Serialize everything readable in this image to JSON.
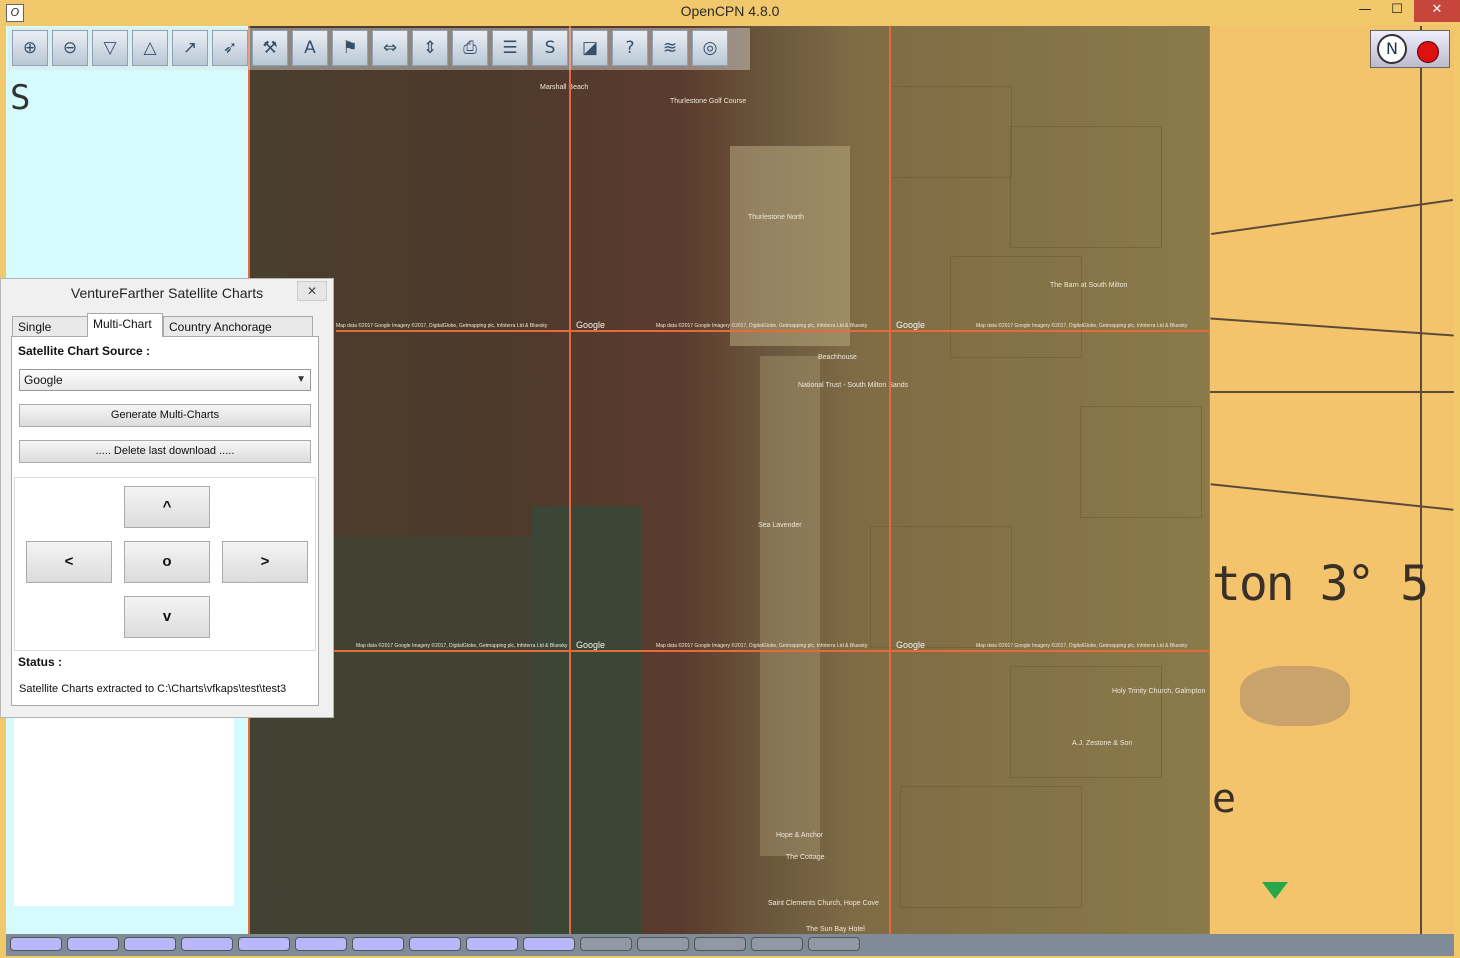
{
  "window": {
    "title": "OpenCPN 4.8.0",
    "app_icon": "O",
    "minimize_label": "—",
    "maximize_label": "☐",
    "close_label": "✕"
  },
  "toolbar": {
    "buttons": [
      {
        "name": "zoom-in-icon",
        "glyph": "⊕"
      },
      {
        "name": "zoom-out-icon",
        "glyph": "⊖"
      },
      {
        "name": "scale-in-icon",
        "glyph": "▽"
      },
      {
        "name": "scale-out-icon",
        "glyph": "△"
      },
      {
        "name": "route-icon",
        "glyph": "↗"
      },
      {
        "name": "auto-follow-icon",
        "glyph": "➶"
      },
      {
        "name": "settings-icon",
        "glyph": "⚒"
      },
      {
        "name": "text-icon",
        "glyph": "A"
      },
      {
        "name": "mark-icon",
        "glyph": "⚑"
      },
      {
        "name": "chart-quilting-icon",
        "glyph": "⇔"
      },
      {
        "name": "depth-icon",
        "glyph": "⇕"
      },
      {
        "name": "print-icon",
        "glyph": "⎙"
      },
      {
        "name": "route-manager-icon",
        "glyph": "☰"
      },
      {
        "name": "track-icon",
        "glyph": "S"
      },
      {
        "name": "color-scheme-icon",
        "glyph": "◪"
      },
      {
        "name": "help-icon",
        "glyph": "?"
      },
      {
        "name": "ais-icon",
        "glyph": "≋"
      },
      {
        "name": "mob-icon",
        "glyph": "◎"
      }
    ]
  },
  "map": {
    "google_tag": "Google",
    "attribution": "Map data ©2017 Google Imagery ©2017, DigitalGlobe, Getmapping plc, Infoterra Ltd & Bluesky",
    "places": [
      "Marshall Beach",
      "Thurlestone Golf Course",
      "Thurlestone North",
      "The Barn at South Milton",
      "Beachhouse",
      "National Trust - South Milton Sands",
      "Sea Lavender",
      "Holy Trinity Church, Galmpton",
      "A.J. Zestone & Son",
      "Hope & Anchor",
      "The Cottage",
      "Saint Clements Church, Hope Cove",
      "The Sun Bay Hotel"
    ],
    "chart_text_main": "ton  3° 5",
    "chart_text_lower": "e",
    "left_edge_text": "S"
  },
  "dialog": {
    "title": "VentureFarther Satellite Charts",
    "close_label": "✕",
    "tabs": [
      {
        "label": "Single Chart"
      },
      {
        "label": "Multi-Chart"
      },
      {
        "label": "Country Anchorage Charts"
      }
    ],
    "source_label": "Satellite Chart Source :",
    "source_value": "Google",
    "generate_button": "Generate Multi-Charts",
    "delete_button": "..... Delete last download .....",
    "nav": {
      "up": "^",
      "left": "<",
      "center": "o",
      "right": ">",
      "down": "v"
    },
    "status_label": "Status :",
    "status_text": "Satellite Charts extracted to C:\\Charts\\vfkaps\\test\\test3"
  },
  "chart_bar": {
    "states": [
      "on",
      "on",
      "on",
      "on",
      "on",
      "on",
      "on",
      "on",
      "on",
      "on",
      "off",
      "off",
      "off",
      "off",
      "off"
    ]
  },
  "colors": {
    "title_bar": "#f1c86b",
    "grid_line": "#e46b3a",
    "chart_bar_on": "#b8b8fb",
    "chart_bar_off": "#8f98a3"
  }
}
